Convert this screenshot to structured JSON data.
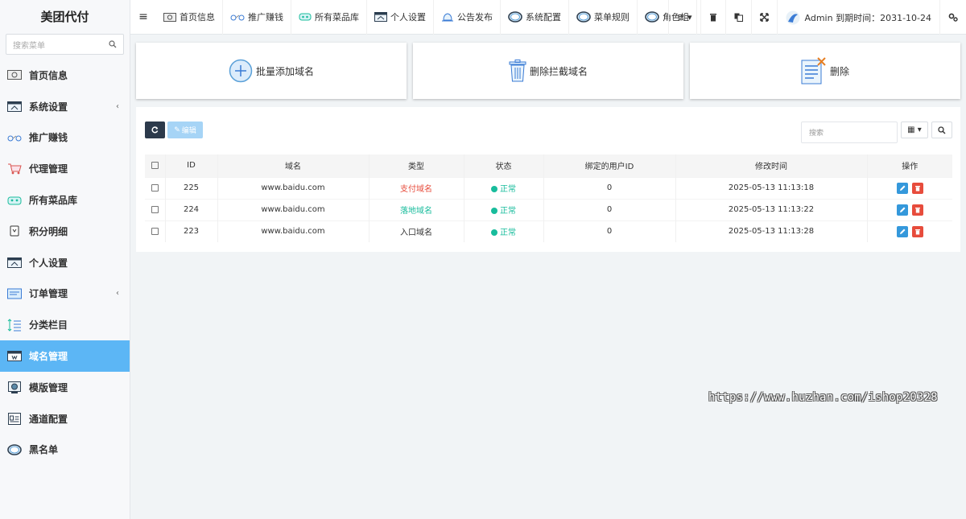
{
  "app": {
    "title": "美团代付"
  },
  "sidebar": {
    "search_placeholder": "搜索菜单",
    "items": [
      {
        "label": "首页信息",
        "icon": "money-icon",
        "expandable": false
      },
      {
        "label": "系统设置",
        "icon": "settings-screen-icon",
        "expandable": true
      },
      {
        "label": "推广赚钱",
        "icon": "promo-icon",
        "expandable": false
      },
      {
        "label": "代理管理",
        "icon": "cart-icon",
        "expandable": false
      },
      {
        "label": "所有菜品库",
        "icon": "dish-icon",
        "expandable": false
      },
      {
        "label": "积分明细",
        "icon": "points-icon",
        "expandable": false
      },
      {
        "label": "个人设置",
        "icon": "profile-screen-icon",
        "expandable": false
      },
      {
        "label": "订单管理",
        "icon": "order-icon",
        "expandable": true
      },
      {
        "label": "分类栏目",
        "icon": "category-icon",
        "expandable": false
      },
      {
        "label": "域名管理",
        "icon": "domain-icon",
        "expandable": false,
        "active": true
      },
      {
        "label": "模版管理",
        "icon": "template-icon",
        "expandable": false
      },
      {
        "label": "通道配置",
        "icon": "channel-icon",
        "expandable": false
      },
      {
        "label": "黑名单",
        "icon": "ring-icon",
        "expandable": false
      }
    ]
  },
  "topbar": {
    "tabs": [
      {
        "label": "首页信息",
        "icon": "money-icon"
      },
      {
        "label": "推广赚钱",
        "icon": "promo-icon"
      },
      {
        "label": "所有菜品库",
        "icon": "dish-icon"
      },
      {
        "label": "个人设置",
        "icon": "profile-screen-icon"
      },
      {
        "label": "公告发布",
        "icon": "bell-icon"
      },
      {
        "label": "系统配置",
        "icon": "ring-icon"
      },
      {
        "label": "菜单规则",
        "icon": "ring-icon"
      },
      {
        "label": "角色组",
        "icon": "ring-icon"
      }
    ],
    "admin_text": "Admin 到期时间：2031-10-24"
  },
  "actions": [
    {
      "label": "批量添加域名",
      "icon": "add-circle-icon"
    },
    {
      "label": "删除拦截域名",
      "icon": "trash-icon"
    },
    {
      "label": "删除",
      "icon": "document-delete-icon"
    }
  ],
  "toolbar": {
    "edit_label": "编辑",
    "search_placeholder": "搜索"
  },
  "table": {
    "columns": [
      "ID",
      "域名",
      "类型",
      "状态",
      "绑定的用户ID",
      "修改时间",
      "操作"
    ],
    "rows": [
      {
        "id": "225",
        "domain": "www.baidu.com",
        "type": "支付域名",
        "type_color": "#e74c3c",
        "status": "正常",
        "user_id": "0",
        "modified": "2025-05-13 11:13:18"
      },
      {
        "id": "224",
        "domain": "www.baidu.com",
        "type": "落地域名",
        "type_color": "#18bc9c",
        "status": "正常",
        "user_id": "0",
        "modified": "2025-05-13 11:13:22"
      },
      {
        "id": "223",
        "domain": "www.baidu.com",
        "type": "入口域名",
        "type_color": "#333333",
        "status": "正常",
        "user_id": "0",
        "modified": "2025-05-13 11:13:28"
      }
    ]
  },
  "watermark": "https://www.huzhan.com/ishop20328",
  "colors": {
    "active": "#5cb6f5",
    "success": "#18bc9c",
    "danger": "#e74c3c",
    "primary": "#3498db",
    "dark": "#2c3a4b"
  }
}
